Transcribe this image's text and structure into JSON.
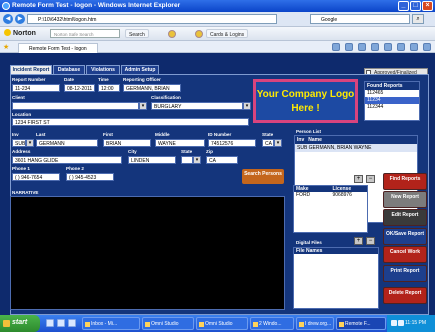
{
  "window": {
    "title": "Remote Form Test - logon - Windows Internet Explorer"
  },
  "address": {
    "url": "P:\\10\\6432\\html\\logon.htm",
    "search_placeholder": "Google"
  },
  "norton": {
    "brand": "Norton",
    "search_placeholder": "Norton Safe Search",
    "search_label": "Search",
    "cards_label": "Cards & Logins"
  },
  "browser_tab": {
    "label": "Remote Form Test - logon"
  },
  "form": {
    "tabs": [
      "Incident Report",
      "Database",
      "Violations",
      "Admin Setup"
    ],
    "approved_label": "Approved/Finalized",
    "report_number_label": "Report Number",
    "report_number": "11-234",
    "date_label": "Date",
    "date": "08-12-2011",
    "time_label": "Time",
    "time": "12:00",
    "reporting_officer_label": "Reporting Officer",
    "reporting_officer": "GERMANN, BRIAN",
    "client_label": "Client",
    "client": "",
    "classification_label": "Classification",
    "classification": "BURGLARY",
    "location_label": "Location",
    "location": "1234 FIRST ST",
    "logo_text": "Your Company Logo Here !",
    "found_reports_label": "Found Reports",
    "found_reports": [
      "112465",
      "11234",
      "112344"
    ],
    "inv_label": "Inv",
    "inv": "SUB",
    "last_label": "Last",
    "last": "GERMANN",
    "first_label": "First",
    "first": "BRIAN",
    "middle_label": "Middle",
    "middle": "WAYNE",
    "id_label": "ID Number",
    "id_number": "74512576",
    "state_label": "State",
    "state": "CA",
    "address_label": "Address",
    "address": "3601 HANG GLIDE",
    "city_label": "City",
    "city": "LINDEN",
    "state2_label": "State",
    "state2": "",
    "zip_label": "Zip",
    "zip": "CA",
    "phone1_label": "Phone 1",
    "phone1": "( ) 946-7654",
    "phone2_label": "Phone 2",
    "phone2": "( ) 945-4523",
    "search_persons_label": "Search Persons",
    "person_list_label": "Person List",
    "person_list_cols": [
      "Inv",
      "Name"
    ],
    "person_list_row": "SUB GERMANN, BRIAN WAYNE",
    "narrative_label": "NARRATIVE",
    "involved_vehicles_label": "Involved Vehicles",
    "vehicle_cols": [
      "Make",
      "License"
    ],
    "vehicle_make": "FORD",
    "vehicle_license": "9068976",
    "digital_files_label": "Digital Files",
    "file_names_label": "File Names",
    "buttons": [
      "Find Reports",
      "New Report",
      "Edit Report",
      "OK/Save Report",
      "Cancel Work",
      "Print Report",
      "Delete Report"
    ]
  },
  "taskbar": {
    "start_label": "start",
    "tasks": [
      "Inbox - Mi...",
      "Omni Studio",
      "Omni Studio",
      "2 Windo...",
      "I drew.org...",
      "Remote F..."
    ],
    "clock": "11:15 PM"
  },
  "colors": {
    "panel": "#14357c",
    "accent_red": "#b2231a",
    "logo_text": "#ffea00",
    "logo_border": "#d8447e"
  }
}
